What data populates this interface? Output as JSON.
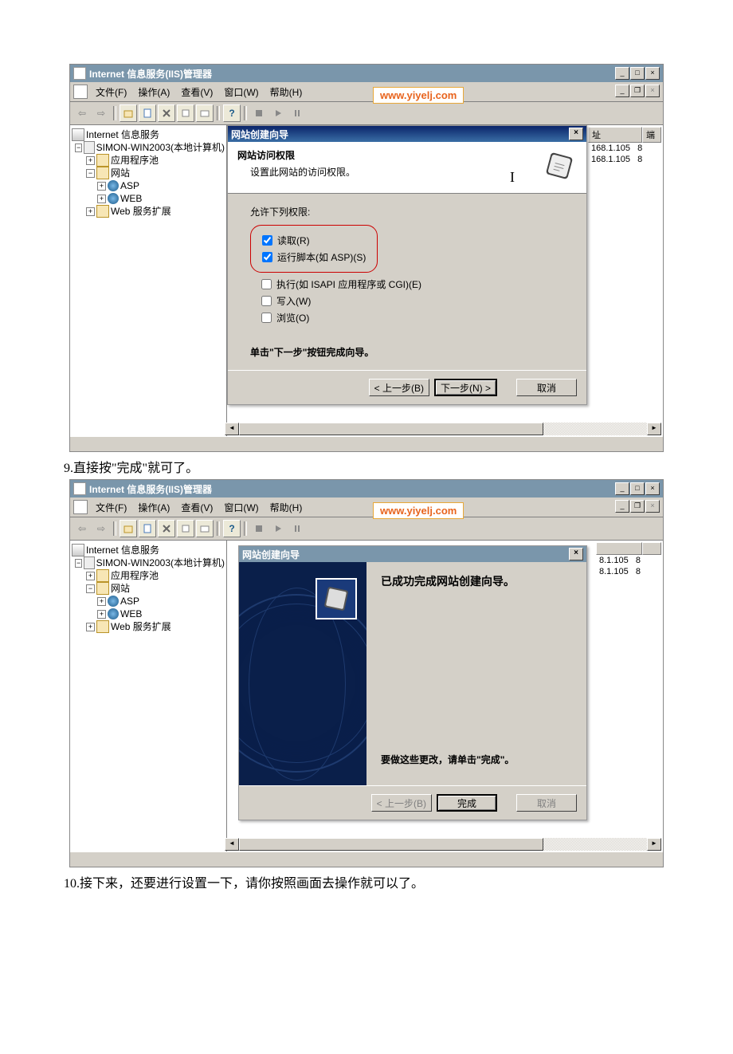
{
  "shot1": {
    "window_title": "Internet 信息服务(IIS)管理器",
    "watermark": "www.yiyelj.com",
    "menu": {
      "file": "文件(F)",
      "action": "操作(A)",
      "view": "查看(V)",
      "window": "窗口(W)",
      "help": "帮助(H)"
    },
    "tree": {
      "root": "Internet 信息服务",
      "server": "SIMON-WIN2003(本地计算机)",
      "apppool": "应用程序池",
      "sites": "网站",
      "asp": "ASP",
      "web": "WEB",
      "ext": "Web 服务扩展"
    },
    "cols": {
      "addr": "址",
      "port": "端"
    },
    "ip1": "168.1.105",
    "ip2": "168.1.105",
    "p1": "8",
    "p2": "8",
    "wizard": {
      "title": "网站创建向导",
      "head_title": "网站访问权限",
      "head_sub": "设置此网站的访问权限。",
      "perm_label": "允许下列权限:",
      "read": "读取(R)",
      "script": "运行脚本(如 ASP)(S)",
      "exec": "执行(如 ISAPI 应用程序或 CGI)(E)",
      "write": "写入(W)",
      "browse": "浏览(O)",
      "hint": "单击\"下一步\"按钮完成向导。",
      "back": "< 上一步(B)",
      "next": "下一步(N) >",
      "cancel": "取消"
    }
  },
  "caption1": "9.直接按\"完成\"就可了。",
  "shot2": {
    "wizard": {
      "title": "网站创建向导",
      "heading": "已成功完成网站创建向导。",
      "msg": "要做这些更改，请单击\"完成\"。",
      "back": "< 上一步(B)",
      "finish": "完成",
      "cancel": "取消"
    },
    "ip1": "8.1.105",
    "ip2": "8.1.105",
    "p1": "8",
    "p2": "8"
  },
  "caption2": "10.接下来，还要进行设置一下，请你按照画面去操作就可以了。"
}
